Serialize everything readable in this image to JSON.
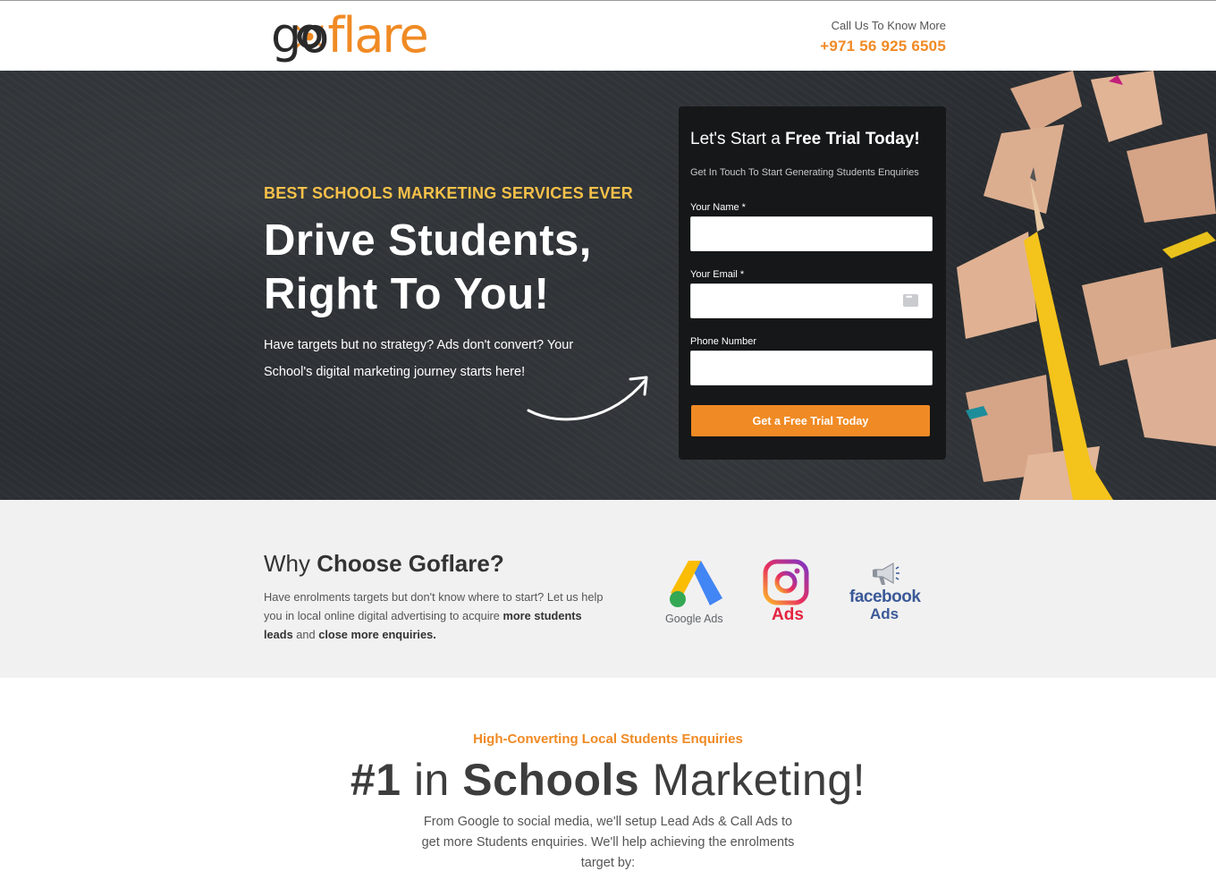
{
  "header": {
    "logo_go": "go",
    "logo_flare": "flare",
    "contact_label": "Call Us To Know More",
    "phone": "+971 56 925 6505"
  },
  "hero": {
    "tagline": "BEST SCHOOLS MARKETING SERVICES EVER",
    "headline_line1": "Drive Students,",
    "headline_line2": "Right To You!",
    "subtext": "Have targets but no strategy? Ads don't convert? Your School's digital marketing journey starts here!"
  },
  "form": {
    "title_plain": "Let's Start a ",
    "title_bold": "Free Trial Today!",
    "subtitle": "Get In Touch To Start Generating Students Enquiries",
    "name_label": "Your Name *",
    "name_value": "",
    "email_label": "Your Email *",
    "email_value": "",
    "phone_label": "Phone Number",
    "phone_value": "",
    "submit_label": "Get a Free Trial Today"
  },
  "why": {
    "title_plain": "Why ",
    "title_bold": "Choose Goflare?",
    "para_start": "Have enrolments targets but don't know where to start? Let us help you in local online digital advertising to acquire ",
    "para_bold1": "more students leads",
    "para_mid": " and ",
    "para_bold2": "close more enquiries.",
    "badges": {
      "google_caption": "Google Ads",
      "instagram_caption": "Ads",
      "facebook_name": "facebook",
      "facebook_caption": "Ads"
    }
  },
  "section": {
    "kicker": "High-Converting Local Students Enquiries",
    "big_bold1": "#1",
    "big_plain1": " in ",
    "big_bold2": "Schools",
    "big_plain2": " Marketing!",
    "desc": "From Google to social media, we'll setup Lead Ads & Call Ads to get more Students enquiries. We'll help achieving the enrolments target by:"
  },
  "colors": {
    "accent": "#f08a24",
    "tagline": "#f7c14a",
    "form_bg": "#161718",
    "hero_bg": "#2b2f33"
  }
}
